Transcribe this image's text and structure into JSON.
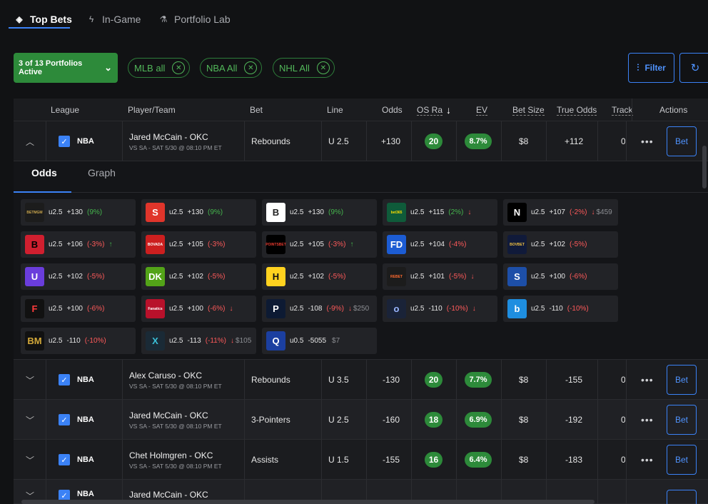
{
  "tabs": [
    {
      "label": "Top Bets",
      "icon": "diamond-icon"
    },
    {
      "label": "In-Game",
      "icon": "lightning-icon"
    },
    {
      "label": "Portfolio Lab",
      "icon": "flask-icon"
    }
  ],
  "filters": {
    "portfolios_label": "3 of 13 Portfolios Active",
    "chips": [
      "MLB all",
      "NBA All",
      "NHL All"
    ],
    "filter_label": "Filter"
  },
  "columns": [
    "League",
    "Player/Team",
    "Bet",
    "Line",
    "Odds",
    "OS Ra",
    "EV",
    "Bet Size",
    "True Odds",
    "Tracke",
    "Actions"
  ],
  "rows": [
    {
      "league": "NBA",
      "player": "Jared McCain - OKC",
      "game": "VS SA - SAT 5/30 @ 08:10 PM ET",
      "bet": "Rebounds",
      "line": "U 2.5",
      "odds": "+130",
      "os": "20",
      "ev": "8.7%",
      "size": "$8",
      "true_odds": "+112",
      "tracked": "0",
      "bet_label": "Bet"
    },
    {
      "league": "NBA",
      "player": "Alex Caruso - OKC",
      "game": "VS SA - SAT 5/30 @ 08:10 PM ET",
      "bet": "Rebounds",
      "line": "U 3.5",
      "odds": "-130",
      "os": "20",
      "ev": "7.7%",
      "size": "$8",
      "true_odds": "-155",
      "tracked": "0",
      "bet_label": "Bet"
    },
    {
      "league": "NBA",
      "player": "Jared McCain - OKC",
      "game": "VS SA - SAT 5/30 @ 08:10 PM ET",
      "bet": "3-Pointers",
      "line": "U 2.5",
      "odds": "-160",
      "os": "18",
      "ev": "6.9%",
      "size": "$8",
      "true_odds": "-192",
      "tracked": "0",
      "bet_label": "Bet"
    },
    {
      "league": "NBA",
      "player": "Chet Holmgren - OKC",
      "game": "VS SA - SAT 5/30 @ 08:10 PM ET",
      "bet": "Assists",
      "line": "U 1.5",
      "odds": "-155",
      "os": "16",
      "ev": "6.4%",
      "size": "$8",
      "true_odds": "-183",
      "tracked": "0",
      "bet_label": "Bet"
    },
    {
      "league": "NBA",
      "player": "Jared McCain - OKC",
      "game": "",
      "bet": "",
      "line": "",
      "odds": "",
      "os": "",
      "ev": "",
      "size": "",
      "true_odds": "",
      "tracked": "",
      "bet_label": ""
    }
  ],
  "expanded": {
    "subtabs": [
      "Odds",
      "Graph"
    ],
    "books": [
      {
        "logo": "BETMGM",
        "logo_bg": "#1c1c1c",
        "logo_fg": "#c8a44c",
        "line": "u2.5",
        "odds": "+130",
        "pct": "(9%)",
        "pct_color": "pos",
        "trend": "",
        "extra": ""
      },
      {
        "logo": "S",
        "logo_bg": "#e0352b",
        "logo_fg": "#ffffff",
        "line": "u2.5",
        "odds": "+130",
        "pct": "(9%)",
        "pct_color": "pos",
        "trend": "",
        "extra": ""
      },
      {
        "logo": "B",
        "logo_bg": "#ffffff",
        "logo_fg": "#222222",
        "line": "u2.5",
        "odds": "+130",
        "pct": "(9%)",
        "pct_color": "pos",
        "trend": "",
        "extra": ""
      },
      {
        "logo": "bet365",
        "logo_bg": "#0f5b3a",
        "logo_fg": "#ffde00",
        "line": "u2.5",
        "odds": "+115",
        "pct": "(2%)",
        "pct_color": "pos",
        "trend": "down",
        "extra": ""
      },
      {
        "logo": "N",
        "logo_bg": "#000000",
        "logo_fg": "#ffffff",
        "line": "u2.5",
        "odds": "+107",
        "pct": "(-2%)",
        "pct_color": "neg",
        "trend": "down",
        "extra": "$459"
      },
      {
        "logo": "B",
        "logo_bg": "#d01f2f",
        "logo_fg": "#000000",
        "line": "u2.5",
        "odds": "+106",
        "pct": "(-3%)",
        "pct_color": "neg",
        "trend": "up",
        "extra": ""
      },
      {
        "logo": "BOVADA",
        "logo_bg": "#cc1f1f",
        "logo_fg": "#ffffff",
        "line": "u2.5",
        "odds": "+105",
        "pct": "(-3%)",
        "pct_color": "neg",
        "trend": "",
        "extra": ""
      },
      {
        "logo": "POINTSBET",
        "logo_bg": "#000000",
        "logo_fg": "#e83a2f",
        "line": "u2.5",
        "odds": "+105",
        "pct": "(-3%)",
        "pct_color": "neg",
        "trend": "up",
        "extra": ""
      },
      {
        "logo": "FD",
        "logo_bg": "#1c5cd3",
        "logo_fg": "#ffffff",
        "line": "u2.5",
        "odds": "+104",
        "pct": "(-4%)",
        "pct_color": "neg",
        "trend": "",
        "extra": ""
      },
      {
        "logo": "BOVBET",
        "logo_bg": "#101a3a",
        "logo_fg": "#f0c040",
        "line": "u2.5",
        "odds": "+102",
        "pct": "(-5%)",
        "pct_color": "neg",
        "trend": "",
        "extra": ""
      },
      {
        "logo": "U",
        "logo_bg": "#6a3ddc",
        "logo_fg": "#ffffff",
        "line": "u2.5",
        "odds": "+102",
        "pct": "(-5%)",
        "pct_color": "neg",
        "trend": "",
        "extra": ""
      },
      {
        "logo": "DK",
        "logo_bg": "#53a318",
        "logo_fg": "#ffffff",
        "line": "u2.5",
        "odds": "+102",
        "pct": "(-5%)",
        "pct_color": "neg",
        "trend": "",
        "extra": ""
      },
      {
        "logo": "H",
        "logo_bg": "#ffd21f",
        "logo_fg": "#111111",
        "line": "u2.5",
        "odds": "+102",
        "pct": "(-5%)",
        "pct_color": "neg",
        "trend": "",
        "extra": ""
      },
      {
        "logo": "REBET",
        "logo_bg": "#1c1c1c",
        "logo_fg": "#ff6a2f",
        "line": "u2.5",
        "odds": "+101",
        "pct": "(-5%)",
        "pct_color": "neg",
        "trend": "down",
        "extra": ""
      },
      {
        "logo": "S",
        "logo_bg": "#1d4fa8",
        "logo_fg": "#ffffff",
        "line": "u2.5",
        "odds": "+100",
        "pct": "(-6%)",
        "pct_color": "neg",
        "trend": "",
        "extra": ""
      },
      {
        "logo": "F",
        "logo_bg": "#111111",
        "logo_fg": "#ff3b3b",
        "line": "u2.5",
        "odds": "+100",
        "pct": "(-6%)",
        "pct_color": "neg",
        "trend": "",
        "extra": ""
      },
      {
        "logo": "Fanatics",
        "logo_bg": "#b8112b",
        "logo_fg": "#ffffff",
        "line": "u2.5",
        "odds": "+100",
        "pct": "(-6%)",
        "pct_color": "neg",
        "trend": "down",
        "extra": ""
      },
      {
        "logo": "P",
        "logo_bg": "#0d1a33",
        "logo_fg": "#ffffff",
        "line": "u2.5",
        "odds": "-108",
        "pct": "(-9%)",
        "pct_color": "neg",
        "trend": "down",
        "extra": "$250"
      },
      {
        "logo": "o",
        "logo_bg": "#1a2338",
        "logo_fg": "#9ab6ff",
        "line": "u2.5",
        "odds": "-110",
        "pct": "(-10%)",
        "pct_color": "neg",
        "trend": "down",
        "extra": ""
      },
      {
        "logo": "b",
        "logo_bg": "#1e8ee0",
        "logo_fg": "#ffffff",
        "line": "u2.5",
        "odds": "-110",
        "pct": "(-10%)",
        "pct_color": "neg",
        "trend": "",
        "extra": ""
      },
      {
        "logo": "BM",
        "logo_bg": "#111111",
        "logo_fg": "#d4a93a",
        "line": "u2.5",
        "odds": "-110",
        "pct": "(-10%)",
        "pct_color": "neg",
        "trend": "",
        "extra": ""
      },
      {
        "logo": "X",
        "logo_bg": "#1a2a36",
        "logo_fg": "#3bc0d8",
        "line": "u2.5",
        "odds": "-113",
        "pct": "(-11%)",
        "pct_color": "neg",
        "trend": "down",
        "extra": "$105"
      },
      {
        "logo": "Q",
        "logo_bg": "#1b3fa0",
        "logo_fg": "#ffffff",
        "line": "u0.5",
        "odds": "-5055",
        "pct": "",
        "pct_color": "mut",
        "trend": "",
        "extra": "$7"
      }
    ]
  },
  "colors": {
    "accent": "#3b82f6",
    "positive": "#2d8a3a",
    "negative": "#ff5a5a"
  }
}
